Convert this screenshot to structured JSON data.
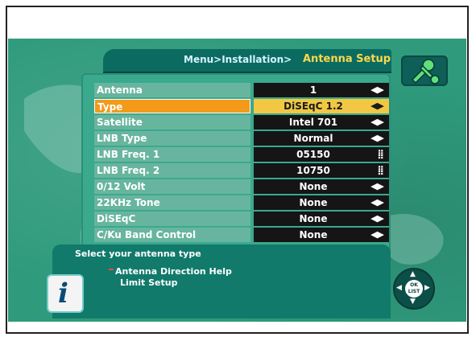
{
  "breadcrumb": "Menu>Installation>",
  "page_title": "Antenna Setup",
  "menu": [
    {
      "label": "Antenna",
      "value": "1",
      "control": "◀▶"
    },
    {
      "label": "Type",
      "value": "DiSEqC 1.2",
      "control": "◀▶",
      "selected": true
    },
    {
      "label": "Satellite",
      "value": "Intel 701",
      "control": "◀▶"
    },
    {
      "label": "LNB Type",
      "value": "Normal",
      "control": "◀▶"
    },
    {
      "label": "LNB Freq. 1",
      "value": "05150",
      "control": "⣿"
    },
    {
      "label": "LNB Freq. 2",
      "value": "10750",
      "control": "⣿"
    },
    {
      "label": "0/12 Volt",
      "value": "None",
      "control": "◀▶"
    },
    {
      "label": "22KHz Tone",
      "value": "None",
      "control": "◀▶"
    },
    {
      "label": "DiSEqC",
      "value": "None",
      "control": "◀▶"
    },
    {
      "label": "C/Ku Band Control",
      "value": "None",
      "control": "◀▶"
    }
  ],
  "help": {
    "title": "Select your antenna type",
    "items": [
      "Antenna Direction Help",
      "Limit Setup"
    ]
  },
  "remote_center": "OK\nLIST",
  "info_glyph": "i",
  "colors": {
    "screen_bg": "#2f9a7c",
    "title_bar": "#0b6b61",
    "title_text": "#ffd84a",
    "row_label_bg": "#68b59f",
    "value_bg": "#151515",
    "selected_label_bg": "#f39a1b",
    "selected_value_bg": "#f2c744"
  }
}
